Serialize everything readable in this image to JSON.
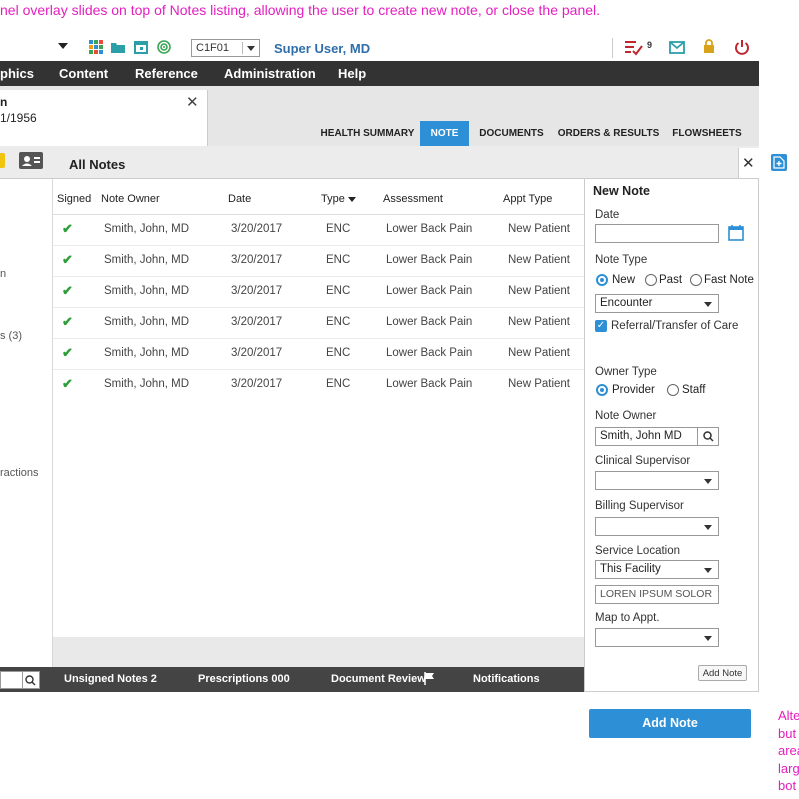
{
  "annotation": {
    "top": "nel overlay slides on top of Notes listing, allowing the user to create new note, or close the panel.",
    "right": "Alte but area larg bot"
  },
  "topbar": {
    "location": "C1F01",
    "user_name": "Super User, MD",
    "task_count": "9",
    "icons": [
      "grid-icon",
      "folder-icon",
      "calendar-icon",
      "signal-icon",
      "tasks-icon",
      "mail-icon",
      "lock-icon",
      "power-icon"
    ]
  },
  "menu": [
    "phics",
    "Content",
    "Reference",
    "Administration",
    "Help"
  ],
  "patient": {
    "name": "n",
    "dob": "1/1956"
  },
  "nav_tabs": [
    "HEALTH SUMMARY",
    "NOTE",
    "DOCUMENTS",
    "ORDERS & RESULTS",
    "FLOWSHEETS"
  ],
  "notes": {
    "title": "All Notes",
    "columns": [
      "Signed",
      "Note Owner",
      "Date",
      "Type",
      "Assessment",
      "Appt Type"
    ],
    "rows": [
      {
        "owner": "Smith, John, MD",
        "date": "3/20/2017",
        "type": "ENC",
        "assessment": "Lower Back Pain",
        "appt": "New Patient"
      },
      {
        "owner": "Smith, John, MD",
        "date": "3/20/2017",
        "type": "ENC",
        "assessment": "Lower Back Pain",
        "appt": "New Patient"
      },
      {
        "owner": "Smith, John, MD",
        "date": "3/20/2017",
        "type": "ENC",
        "assessment": "Lower Back Pain",
        "appt": "New Patient"
      },
      {
        "owner": "Smith, John, MD",
        "date": "3/20/2017",
        "type": "ENC",
        "assessment": "Lower Back Pain",
        "appt": "New Patient"
      },
      {
        "owner": "Smith, John, MD",
        "date": "3/20/2017",
        "type": "ENC",
        "assessment": "Lower Back Pain",
        "appt": "New Patient"
      },
      {
        "owner": "Smith, John, MD",
        "date": "3/20/2017",
        "type": "ENC",
        "assessment": "Lower Back Pain",
        "appt": "New Patient"
      }
    ]
  },
  "sidebar": {
    "items": [
      "n",
      "s (3)",
      "ractions"
    ]
  },
  "statusbar": {
    "unsigned": "Unsigned Notes 2",
    "prescriptions": "Prescriptions 000",
    "document_review": "Document Review",
    "notifications": "Notifications"
  },
  "panel": {
    "title": "New Note",
    "date_label": "Date",
    "date_value": "",
    "note_type_label": "Note Type",
    "note_type_options": [
      "New",
      "Past",
      "Fast Note"
    ],
    "note_type_selected": "New",
    "note_category": "Encounter",
    "referral_label": "Referral/Transfer of Care",
    "owner_type_label": "Owner Type",
    "owner_type_options": [
      "Provider",
      "Staff"
    ],
    "owner_type_selected": "Provider",
    "note_owner_label": "Note Owner",
    "note_owner_value": "Smith, John MD",
    "clinical_supervisor_label": "Clinical Supervisor",
    "billing_supervisor_label": "Billing Supervisor",
    "service_location_label": "Service Location",
    "service_location_value": "This Facility",
    "location_text": "LOREN IPSUM SOLOR",
    "map_appt_label": "Map to Appt.",
    "add_note_small": "Add Note"
  },
  "add_note_button": "Add Note",
  "colors": {
    "accent": "#2d8fd5",
    "menubar": "#333333",
    "annotation": "#e41fbf",
    "check": "#2e9e3a"
  }
}
